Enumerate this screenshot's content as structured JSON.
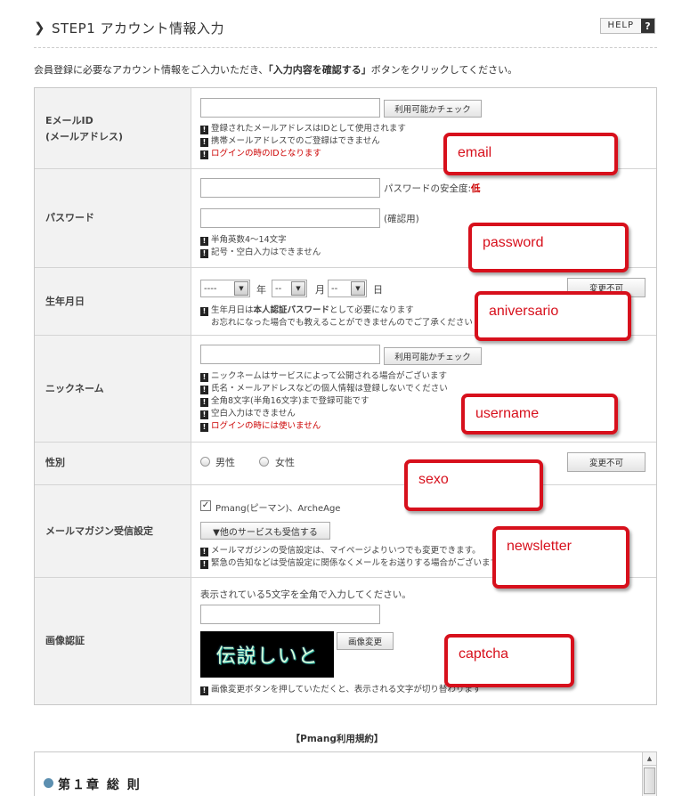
{
  "header": {
    "title": "STEP1 アカウント情報入力",
    "help_label": "HELP",
    "help_icon": "?"
  },
  "intro": {
    "pre": "会員登録に必要なアカウント情報をご入力いただき、",
    "bold": "「入力内容を確認する」",
    "post": "ボタンをクリックしてください。"
  },
  "email": {
    "label_1": "EメールID",
    "label_2": "(メールアドレス)",
    "check_button": "利用可能かチェック",
    "notes": [
      "登録されたメールアドレスはIDとして使用されます",
      "携帯メールアドレスでのご登録はできません",
      "ログインの時のIDとなります"
    ]
  },
  "password": {
    "label": "パスワード",
    "strength_label": "パスワードの安全度:",
    "strength_value": "低",
    "confirm_label": "(確認用)",
    "notes": [
      "半角英数4〜14文字",
      "記号・空白入力はできません"
    ]
  },
  "birthday": {
    "label": "生年月日",
    "year_value": "----",
    "year_unit": "年",
    "month_value": "--",
    "month_unit": "月",
    "day_value": "--",
    "day_unit": "日",
    "change_button": "変更不可",
    "note_1_pre": "生年月日は",
    "note_1_bold": "本人認証パスワード",
    "note_1_post": "として必要になります",
    "note_2": "お忘れになった場合でも教えることができませんのでご了承ください"
  },
  "nickname": {
    "label": "ニックネーム",
    "check_button": "利用可能かチェック",
    "notes": [
      "ニックネームはサービスによって公開される場合がございます",
      "氏名・メールアドレスなどの個人情報は登録しないでください",
      "全角8文字(半角16文字)まで登録可能です",
      "空白入力はできません",
      "ログインの時には使いません"
    ]
  },
  "gender": {
    "label": "性別",
    "male": "男性",
    "female": "女性",
    "change_button": "変更不可"
  },
  "newsletter": {
    "label": "メールマガジン受信設定",
    "checkbox_label": "Pmang(ピーマン)、ArcheAge",
    "other_button": "▼他のサービスも受信する",
    "notes": [
      "メールマガジンの受信設定は、マイページよりいつでも変更できます。",
      "緊急の告知などは受信設定に関係なくメールをお送りする場合がございます"
    ]
  },
  "captcha": {
    "label": "画像認証",
    "instruction": "表示されている5文字を全角で入力してください。",
    "image_text": "伝説しいと",
    "change_button": "画像変更",
    "note": "画像変更ボタンを押していただくと、表示される文字が切り替わります"
  },
  "annotations": {
    "email": "email",
    "password": "password",
    "birthday": "aniversario",
    "username": "username",
    "gender": "sexo",
    "newsletter": "newsletter",
    "captcha": "captcha"
  },
  "terms": {
    "title": "【Pmang利用規約】",
    "chapter": "第１章 総 則"
  },
  "colors": {
    "annotation": "#d7101c",
    "warning": "#cc0000"
  }
}
